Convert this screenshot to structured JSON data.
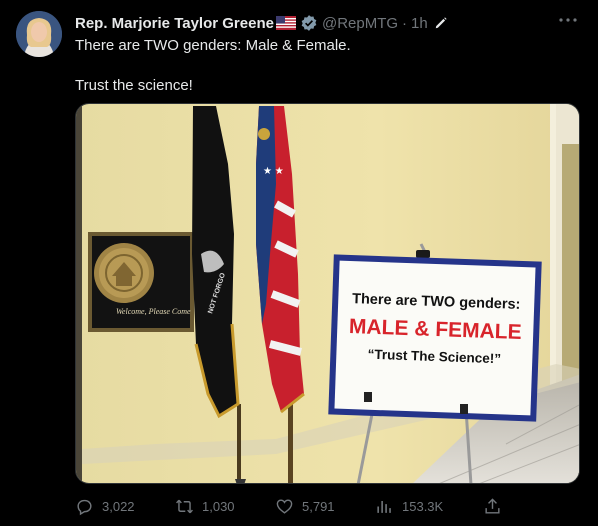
{
  "tweet": {
    "author_name": "Rep. Marjorie Taylor Greene",
    "handle": "@RepMTG",
    "separator": "·",
    "time": "1h",
    "text_line1": "There are TWO genders: Male & Female.",
    "text_line2": "Trust the science!"
  },
  "image": {
    "plaque_text": "Welcome, Please Come",
    "sign_line1": "There are TWO genders:",
    "sign_line2": "MALE & FEMALE",
    "sign_line3": "“Trust The Science!”",
    "flag_text": "NOT FORGO"
  },
  "actions": {
    "replies": "3,022",
    "reposts": "1,030",
    "likes": "5,791",
    "views": "153.3K"
  },
  "colors": {
    "background": "#000000",
    "text": "#e7e9ea",
    "muted": "#71767b",
    "verified_gray": "#829aab",
    "sign_red": "#d8242b",
    "sign_blue": "#25348a"
  },
  "icons": [
    "more-icon",
    "verified-icon",
    "flag-icon",
    "edit-icon",
    "reply-icon",
    "repost-icon",
    "like-icon",
    "views-icon",
    "share-icon"
  ]
}
